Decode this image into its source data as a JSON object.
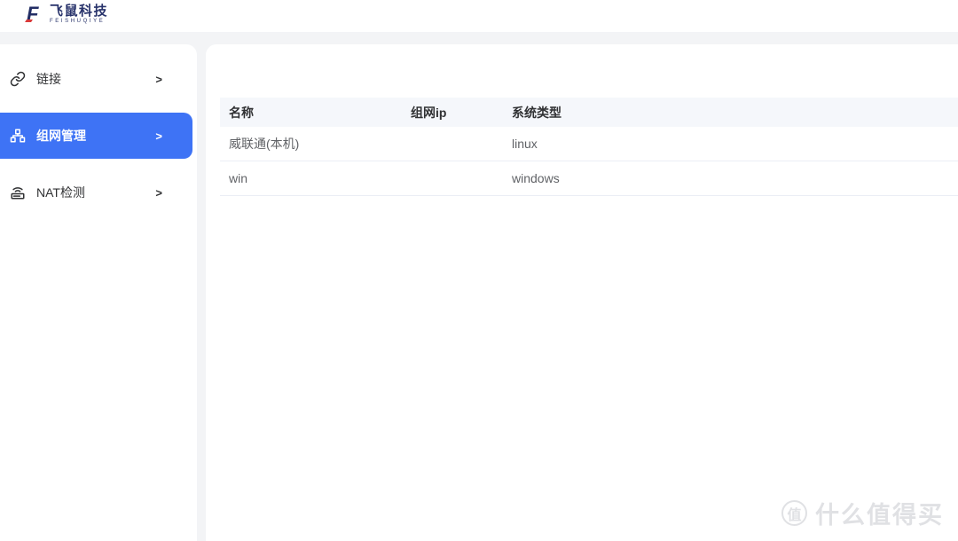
{
  "topbar": {
    "logo": {
      "mark": "F",
      "brand": "飞鼠科技",
      "sub": "FEISHUQIYE"
    }
  },
  "sidebar": {
    "chevron": ">",
    "items": [
      {
        "label": "链接",
        "icon": "link-icon",
        "active": false
      },
      {
        "label": "组网管理",
        "icon": "sitemap-icon",
        "active": true
      },
      {
        "label": "NAT检测",
        "icon": "router-icon",
        "active": false
      }
    ]
  },
  "main": {
    "table": {
      "columns": [
        "名称",
        "组网ip",
        "系统类型"
      ],
      "rows": [
        {
          "name": "威联通(本机)",
          "ip_redacted": true,
          "os": "linux"
        },
        {
          "name": "win",
          "ip_redacted": true,
          "os": "windows"
        }
      ]
    }
  },
  "watermark": {
    "badge": "值",
    "text": "什么值得买"
  },
  "colors": {
    "accent_blue": "#3e73f5",
    "logo_navy": "#28336b",
    "logo_red": "#d93a3a",
    "table_header_bg": "#f5f7fb",
    "row_border": "#ebeef5",
    "text_primary": "#303133",
    "text_secondary": "#606266",
    "page_bg": "#f3f4f6",
    "mosaic_blue": "#cfe1f9",
    "watermark_gray": "#e0e1e4"
  }
}
